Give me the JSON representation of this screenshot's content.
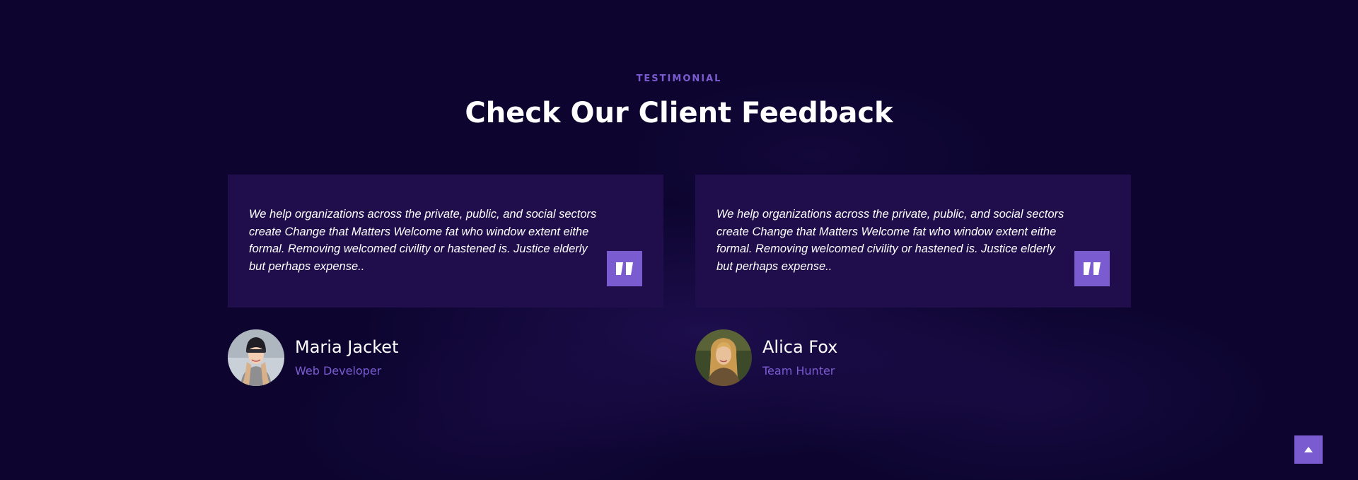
{
  "section": {
    "eyebrow": "TESTIMONIAL",
    "title": "Check Our Client Feedback"
  },
  "testimonials": [
    {
      "quote": "We help organizations across the private, public, and social sectors create Change that Matters Welcome fat who window extent eithe formal. Removing welcomed civility or hastened is. Justice elderly but perhaps expense..",
      "name": "Maria Jacket",
      "role": "Web Developer",
      "quote_icon": "quote-icon",
      "avatar_icon": "avatar-woman-beanie"
    },
    {
      "quote": "We help organizations across the private, public, and social sectors create Change that Matters Welcome fat who window extent eithe formal. Removing welcomed civility or hastened is. Justice elderly but perhaps expense..",
      "name": "Alica Fox",
      "role": "Team Hunter",
      "quote_icon": "quote-icon",
      "avatar_icon": "avatar-woman-blonde"
    }
  ],
  "scroll_top": {
    "icon": "arrow-up-icon"
  },
  "colors": {
    "background": "#0d0530",
    "card": "#1f0e4b",
    "accent": "#7b5bd0",
    "text": "#ffffff"
  }
}
